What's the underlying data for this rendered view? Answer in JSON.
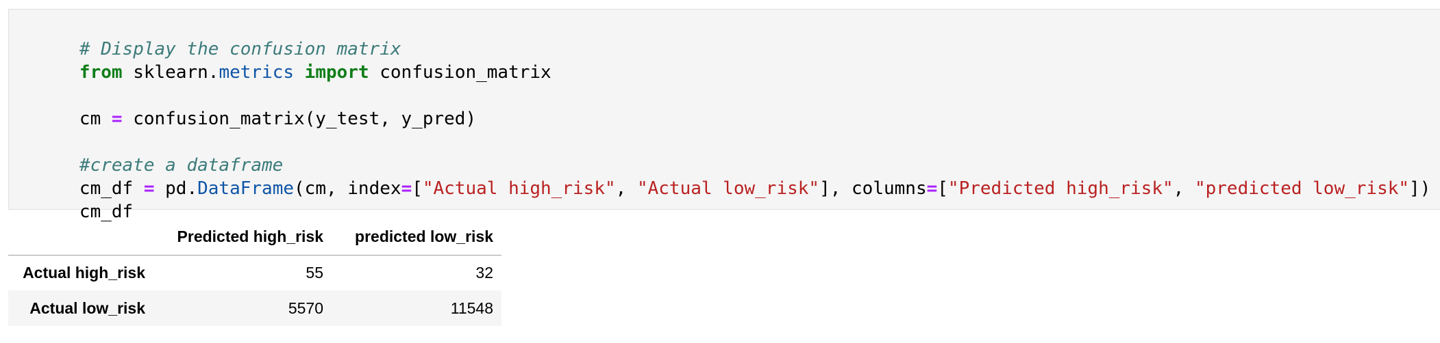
{
  "code_cell": {
    "lines": [
      [
        {
          "cls": "tok-comment",
          "text": "# Display the confusion matrix"
        }
      ],
      [
        {
          "cls": "tok-kw",
          "text": "from"
        },
        {
          "cls": "tok-plain",
          "text": " sklearn."
        },
        {
          "cls": "tok-mod",
          "text": "metrics"
        },
        {
          "cls": "tok-plain",
          "text": " "
        },
        {
          "cls": "tok-kw",
          "text": "import"
        },
        {
          "cls": "tok-plain",
          "text": " confusion_matrix"
        }
      ],
      [],
      [
        {
          "cls": "tok-plain",
          "text": "cm "
        },
        {
          "cls": "tok-op",
          "text": "="
        },
        {
          "cls": "tok-plain",
          "text": " confusion_matrix(y_test, y_pred)"
        }
      ],
      [],
      [
        {
          "cls": "tok-comment",
          "text": "#create a dataframe"
        }
      ],
      [
        {
          "cls": "tok-plain",
          "text": "cm_df "
        },
        {
          "cls": "tok-op",
          "text": "="
        },
        {
          "cls": "tok-plain",
          "text": " pd."
        },
        {
          "cls": "tok-mod",
          "text": "DataFrame"
        },
        {
          "cls": "tok-plain",
          "text": "(cm, index"
        },
        {
          "cls": "tok-op",
          "text": "="
        },
        {
          "cls": "tok-plain",
          "text": "["
        },
        {
          "cls": "tok-str",
          "text": "\"Actual high_risk\""
        },
        {
          "cls": "tok-plain",
          "text": ", "
        },
        {
          "cls": "tok-str",
          "text": "\"Actual low_risk\""
        },
        {
          "cls": "tok-plain",
          "text": "], columns"
        },
        {
          "cls": "tok-op",
          "text": "="
        },
        {
          "cls": "tok-plain",
          "text": "["
        },
        {
          "cls": "tok-str",
          "text": "\"Predicted high_risk\""
        },
        {
          "cls": "tok-plain",
          "text": ", "
        },
        {
          "cls": "tok-str",
          "text": "\"predicted low_risk\""
        },
        {
          "cls": "tok-plain",
          "text": "])"
        }
      ],
      [
        {
          "cls": "tok-plain",
          "text": "cm_df"
        }
      ]
    ]
  },
  "output_table": {
    "columns": [
      "",
      "Predicted high_risk",
      "predicted low_risk"
    ],
    "rows": [
      {
        "index": "Actual high_risk",
        "values": [
          "55",
          "32"
        ]
      },
      {
        "index": "Actual low_risk",
        "values": [
          "5570",
          "11548"
        ]
      }
    ]
  }
}
